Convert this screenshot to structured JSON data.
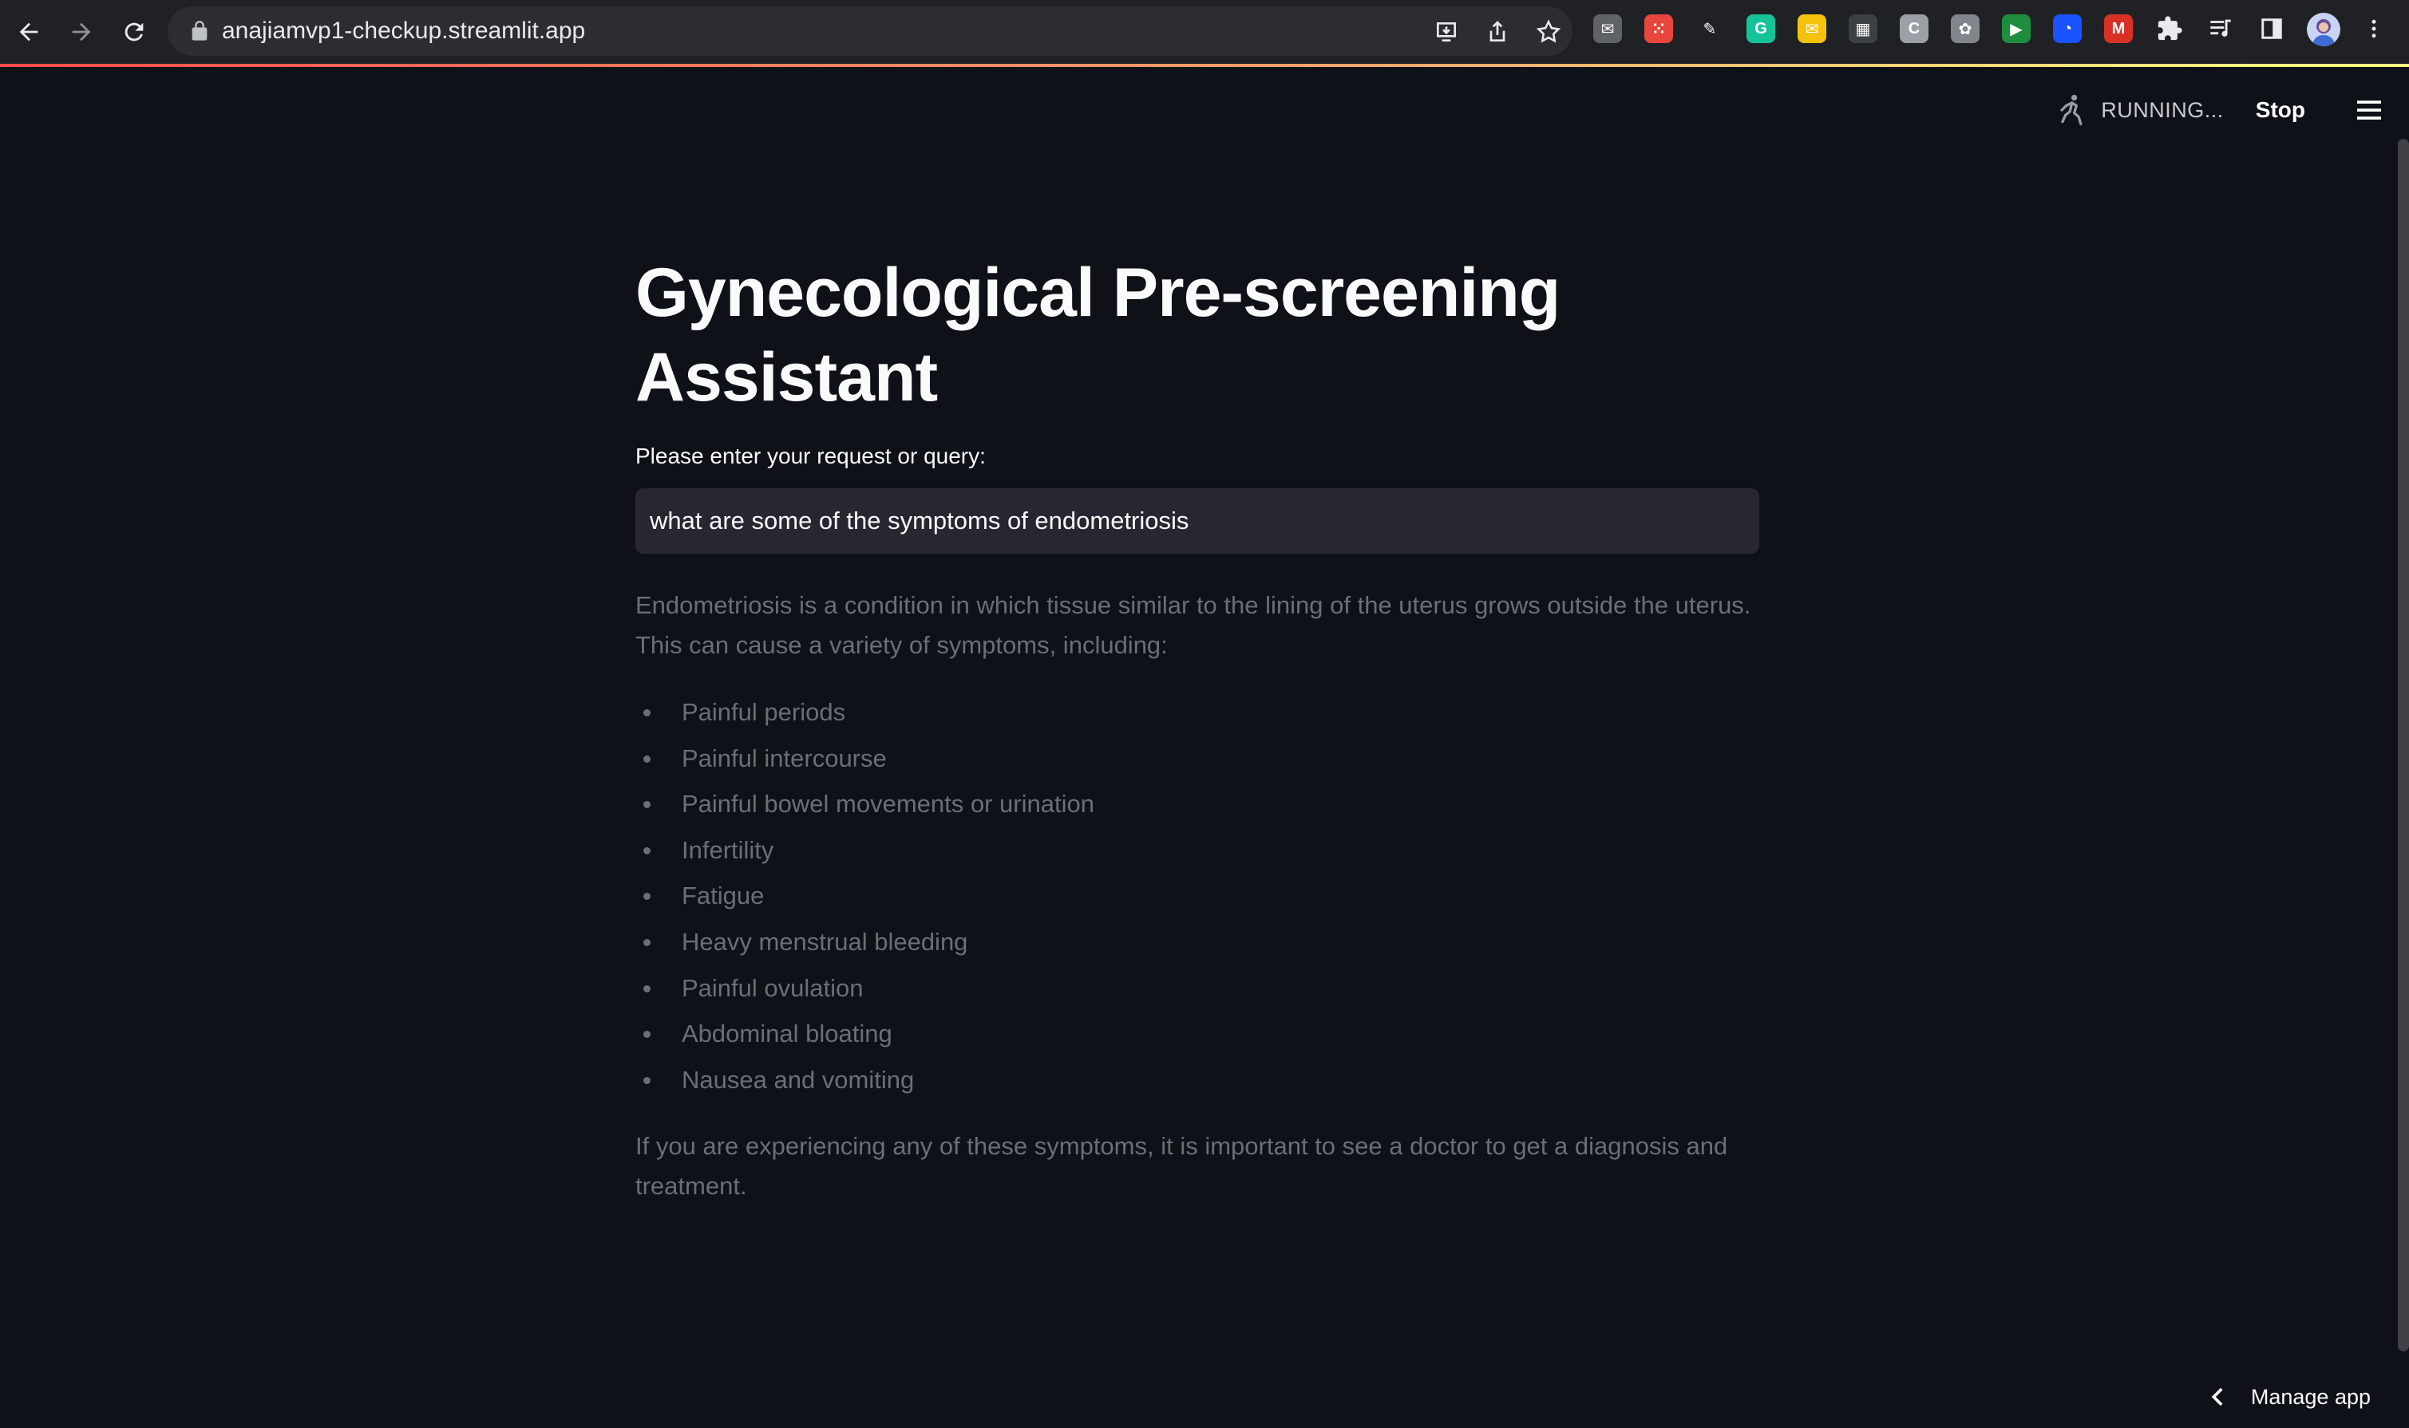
{
  "browser": {
    "url": "anajiamvp1-checkup.streamlit.app",
    "extensions": [
      {
        "name": "mail-extension-icon",
        "color": "#5f6368",
        "glyph": "✉"
      },
      {
        "name": "red-dots-extension-icon",
        "color": "#e8453c",
        "glyph": "⁙"
      },
      {
        "name": "eyedropper-extension-icon",
        "color": "#202124",
        "glyph": "✎"
      },
      {
        "name": "grammarly-extension-icon",
        "color": "#15c39a",
        "glyph": "G"
      },
      {
        "name": "chat-extension-icon",
        "color": "#f4c20d",
        "glyph": "✉"
      },
      {
        "name": "grid-extension-icon",
        "color": "#3c4043",
        "glyph": "▦"
      },
      {
        "name": "grey-circle-extension-icon",
        "color": "#9aa0a6",
        "glyph": "C"
      },
      {
        "name": "settings-extension-icon",
        "color": "#80868b",
        "glyph": "✿"
      },
      {
        "name": "video-extension-icon",
        "color": "#1e8e3e",
        "glyph": "▶"
      },
      {
        "name": "blue-pie-extension-icon",
        "color": "#1a53ff",
        "glyph": "◔"
      },
      {
        "name": "mendeley-extension-icon",
        "color": "#d93025",
        "glyph": "M"
      }
    ]
  },
  "header": {
    "status": "RUNNING...",
    "stop_label": "Stop"
  },
  "main": {
    "title": "Gynecological Pre-screening Assistant",
    "input_label": "Please enter your request or query:",
    "input_value": "what are some of the symptoms of endometriosis",
    "answer_intro": "Endometriosis is a condition in which tissue similar to the lining of the uterus grows outside the uterus. This can cause a variety of symptoms, including:",
    "symptoms": [
      "Painful periods",
      "Painful intercourse",
      "Painful bowel movements or urination",
      "Infertility",
      "Fatigue",
      "Heavy menstrual bleeding",
      "Painful ovulation",
      "Abdominal bloating",
      "Nausea and vomiting"
    ],
    "answer_outro": "If you are experiencing any of these symptoms, it is important to see a doctor to get a diagnosis and treatment."
  },
  "footer": {
    "manage_app_label": "Manage app"
  }
}
